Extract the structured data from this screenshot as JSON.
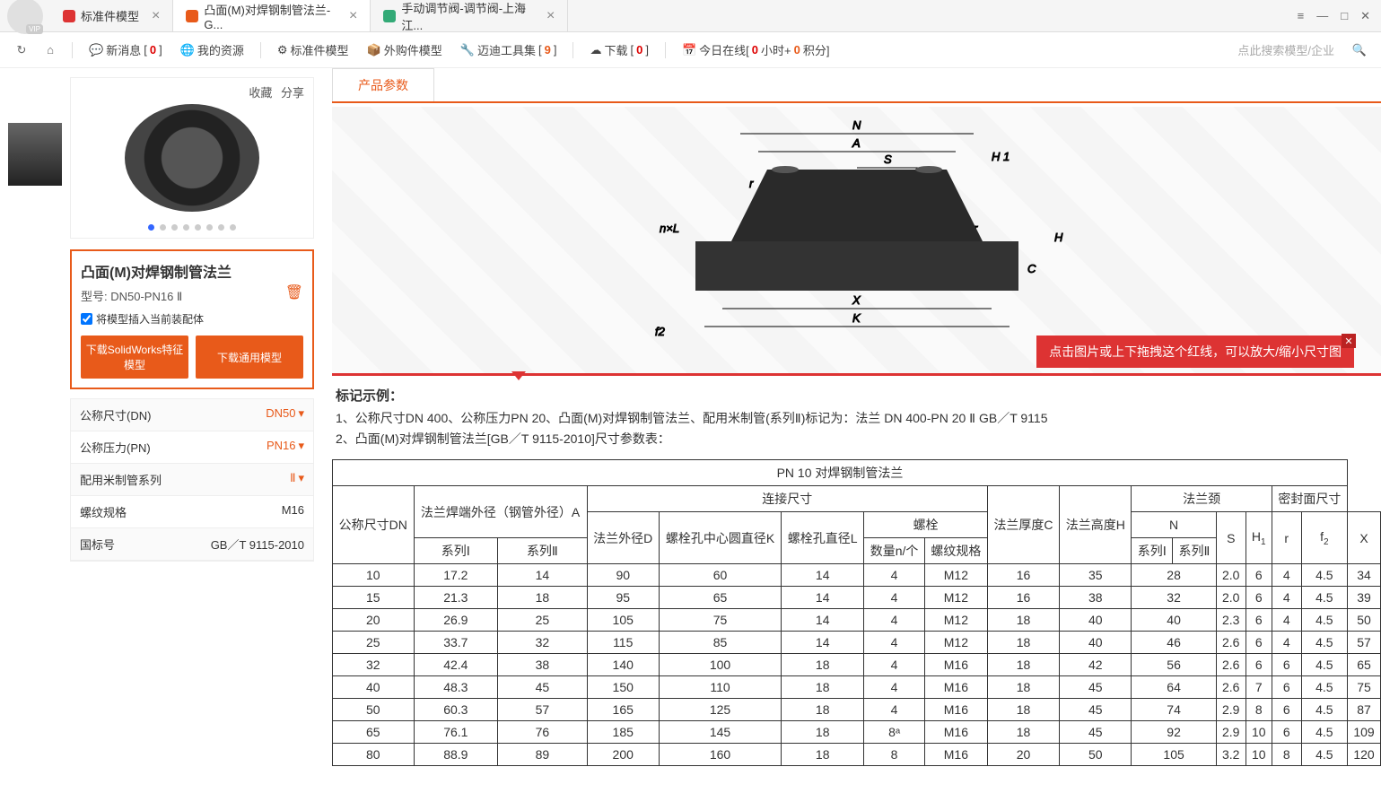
{
  "avatar": {
    "vip": "VIP"
  },
  "tabs": [
    {
      "label": "标准件模型",
      "active": false,
      "icon": "red"
    },
    {
      "label": "凸面(M)对焊钢制管法兰-G...",
      "active": true,
      "icon": "orange"
    },
    {
      "label": "手动调节阀-调节阀-上海江...",
      "active": false,
      "icon": "green"
    }
  ],
  "winctrl": {
    "menu": "≡",
    "min": "—",
    "max": "□",
    "close": "✕"
  },
  "toolbar": {
    "newmsg": {
      "label": "新消息",
      "count": "0"
    },
    "myres": "我的资源",
    "stdmodel": "标准件模型",
    "buymodel": "外购件模型",
    "toolset": {
      "label": "迈迪工具集",
      "count": "9"
    },
    "download": {
      "label": "下载",
      "count": "0"
    },
    "online": {
      "prefix": "今日在线[",
      "h": "0",
      "hl": "小时+ ",
      "p": "0",
      "pl": "积分]"
    },
    "search_hint": "点此搜索模型/企业"
  },
  "gallery": {
    "fav": "收藏",
    "share": "分享"
  },
  "info": {
    "title": "凸面(M)对焊钢制管法兰",
    "model_label": "型号: ",
    "model": "DN50-PN16 Ⅱ",
    "chk": "将模型插入当前装配体",
    "btn1": "下载SolidWorks特征模型",
    "btn2": "下载通用模型"
  },
  "params": [
    {
      "k": "公称尺寸(DN)",
      "v": "DN50",
      "dd": true
    },
    {
      "k": "公称压力(PN)",
      "v": "PN16",
      "dd": true
    },
    {
      "k": "配用米制管系列",
      "v": "Ⅱ",
      "dd": true
    },
    {
      "k": "螺纹规格",
      "v": "M16",
      "dd": false
    },
    {
      "k": "国标号",
      "v": "GB／T 9115-2010",
      "dd": false
    }
  ],
  "content_tab": "产品参数",
  "tip": "点击图片或上下拖拽这个红线，可以放大/缩小尺寸图",
  "diagram_labels": {
    "N": "N",
    "A": "A",
    "S": "S",
    "r": "r",
    "H1": "H 1",
    "H": "H",
    "C": "C",
    "nxL": "n×L",
    "f2": "f2",
    "X": "X",
    "K": "K"
  },
  "notes": {
    "title": "标记示例：",
    "l1": "1、公称尺寸DN 400、公称压力PN 20、凸面(M)对焊钢制管法兰、配用米制管(系列Ⅱ)标记为：法兰 DN 400-PN 20 Ⅱ GB／T 9115",
    "l2": "2、凸面(M)对焊钢制管法兰[GB／T 9115-2010]尺寸参数表："
  },
  "table": {
    "caption": "PN 10 对焊钢制管法兰",
    "headers": {
      "dn": "公称尺寸DN",
      "od": "法兰焊端外径（钢管外径）A",
      "conn": "连接尺寸",
      "thk": "法兰厚度C",
      "h": "法兰高度H",
      "neck": "法兰颈",
      "seal": "密封面尺寸",
      "s1": "系列Ⅰ",
      "s2": "系列Ⅱ",
      "D": "法兰外径D",
      "K": "螺栓孔中心圆直径K",
      "L": "螺栓孔直径L",
      "bolt": "螺栓",
      "qty": "数量n/个",
      "th": "螺纹规格",
      "N": "N",
      "S": "S",
      "H1": "H",
      "r": "r",
      "f2": "f",
      "X": "X"
    },
    "rows": [
      [
        "10",
        "17.2",
        "14",
        "90",
        "60",
        "14",
        "4",
        "M12",
        "16",
        "35",
        "28",
        "2.0",
        "6",
        "4",
        "4.5",
        "34"
      ],
      [
        "15",
        "21.3",
        "18",
        "95",
        "65",
        "14",
        "4",
        "M12",
        "16",
        "38",
        "32",
        "2.0",
        "6",
        "4",
        "4.5",
        "39"
      ],
      [
        "20",
        "26.9",
        "25",
        "105",
        "75",
        "14",
        "4",
        "M12",
        "18",
        "40",
        "40",
        "2.3",
        "6",
        "4",
        "4.5",
        "50"
      ],
      [
        "25",
        "33.7",
        "32",
        "115",
        "85",
        "14",
        "4",
        "M12",
        "18",
        "40",
        "46",
        "2.6",
        "6",
        "4",
        "4.5",
        "57"
      ],
      [
        "32",
        "42.4",
        "38",
        "140",
        "100",
        "18",
        "4",
        "M16",
        "18",
        "42",
        "56",
        "2.6",
        "6",
        "6",
        "4.5",
        "65"
      ],
      [
        "40",
        "48.3",
        "45",
        "150",
        "110",
        "18",
        "4",
        "M16",
        "18",
        "45",
        "64",
        "2.6",
        "7",
        "6",
        "4.5",
        "75"
      ],
      [
        "50",
        "60.3",
        "57",
        "165",
        "125",
        "18",
        "4",
        "M16",
        "18",
        "45",
        "74",
        "2.9",
        "8",
        "6",
        "4.5",
        "87"
      ],
      [
        "65",
        "76.1",
        "76",
        "185",
        "145",
        "18",
        "8ᵃ",
        "M16",
        "18",
        "45",
        "92",
        "2.9",
        "10",
        "6",
        "4.5",
        "109"
      ],
      [
        "80",
        "88.9",
        "89",
        "200",
        "160",
        "18",
        "8",
        "M16",
        "20",
        "50",
        "105",
        "3.2",
        "10",
        "8",
        "4.5",
        "120"
      ]
    ]
  }
}
